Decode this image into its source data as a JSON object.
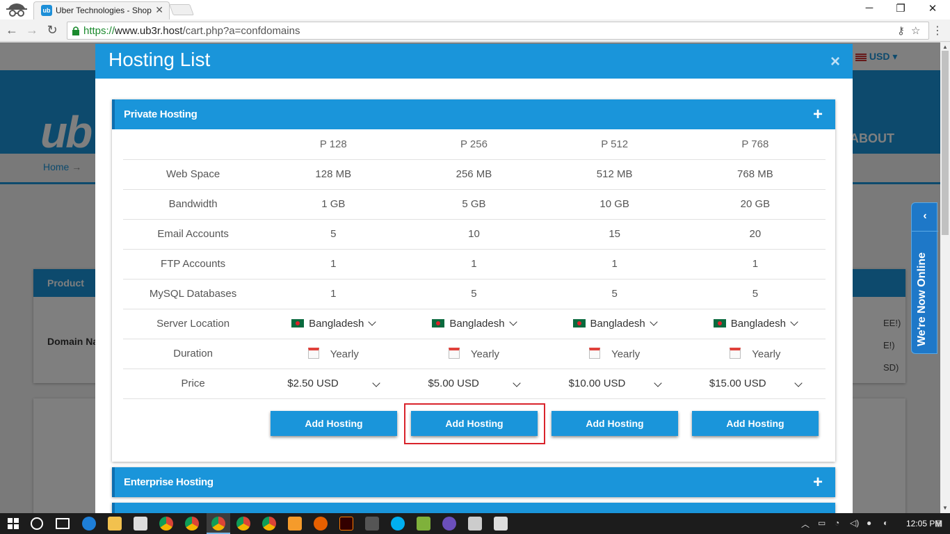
{
  "browser": {
    "tab_title": "Uber Technologies - Shop",
    "tab_favicon_text": "ub",
    "url_scheme": "https://",
    "url_host": "www.ub3r.host",
    "url_path": "/cart.php?a=confdomains"
  },
  "page": {
    "logo_text": "ub",
    "nav_about": "ABOUT",
    "currency": "USD",
    "breadcrumb_home": "Home",
    "breadcrumb_arrow": "→",
    "product_header": "Product",
    "domain_label": "Domain Na",
    "right_fragments": [
      "EE!)",
      "E!)",
      "SD)"
    ]
  },
  "livechat": {
    "chevron": "‹",
    "label": "We're Now Online"
  },
  "modal": {
    "title": "Hosting List",
    "close": "×",
    "private_panel": {
      "title": "Private Hosting",
      "toggle": "+",
      "plans": [
        "P 128",
        "P 256",
        "P 512",
        "P 768"
      ],
      "rows": [
        {
          "label": "Web Space",
          "values": [
            "128 MB",
            "256 MB",
            "512 MB",
            "768 MB"
          ]
        },
        {
          "label": "Bandwidth",
          "values": [
            "1 GB",
            "5 GB",
            "10 GB",
            "20 GB"
          ]
        },
        {
          "label": "Email Accounts",
          "values": [
            "5",
            "10",
            "15",
            "20"
          ]
        },
        {
          "label": "FTP Accounts",
          "values": [
            "1",
            "1",
            "1",
            "1"
          ]
        },
        {
          "label": "MySQL Databases",
          "values": [
            "1",
            "5",
            "5",
            "5"
          ]
        }
      ],
      "location_label": "Server Location",
      "locations": [
        "Bangladesh",
        "Bangladesh",
        "Bangladesh",
        "Bangladesh"
      ],
      "duration_label": "Duration",
      "durations": [
        "Yearly",
        "Yearly",
        "Yearly",
        "Yearly"
      ],
      "price_label": "Price",
      "prices": [
        "$2.50 USD",
        "$5.00 USD",
        "$10.00 USD",
        "$15.00 USD"
      ],
      "button_label": "Add Hosting"
    },
    "enterprise_panel": {
      "title": "Enterprise Hosting",
      "toggle": "+"
    }
  },
  "taskbar": {
    "clock": "12:05 PM"
  },
  "colors": {
    "brand_blue": "#1a95da",
    "highlight_red": "#d9232b",
    "bd_flag_green": "#0a6a3e",
    "bd_flag_red": "#e0202a"
  }
}
